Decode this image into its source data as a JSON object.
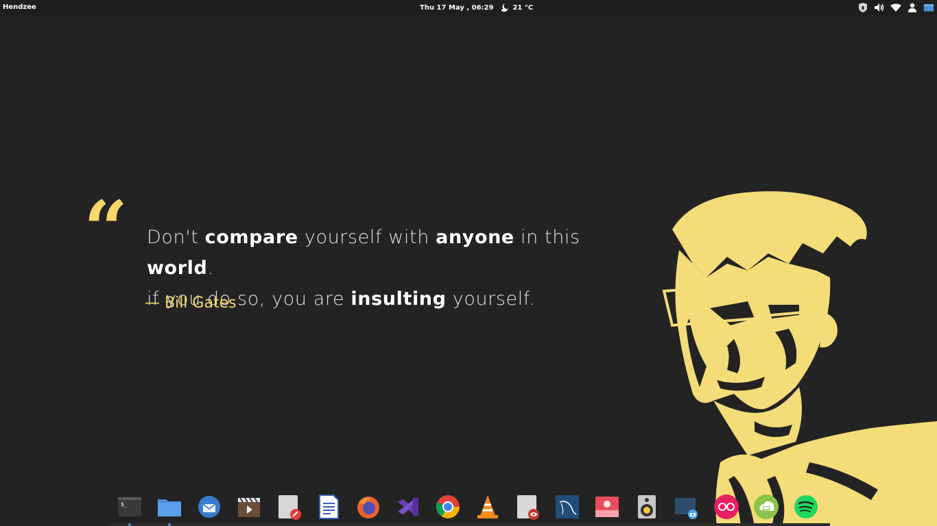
{
  "panel": {
    "app_menu_label": "Hendzee",
    "clock": "Thu 17 May , 06:29",
    "weather_temp": "21 °C",
    "indicators": [
      "security-icon",
      "volume-icon",
      "wifi-icon",
      "user-icon",
      "workspace-icon"
    ]
  },
  "wallpaper": {
    "quote_mark": "“",
    "line1": {
      "a": "Don't ",
      "b": "compare",
      "c": " yourself with ",
      "d": "anyone",
      "e": " in this ",
      "f": "world",
      "g": "."
    },
    "line2": {
      "a": "if you do so, you are ",
      "b": "insulting",
      "c": " yourself."
    },
    "author": "— Bill Gates",
    "accent_color": "#f6d86a"
  },
  "dock": {
    "items": [
      {
        "name": "terminal-icon"
      },
      {
        "name": "files-icon"
      },
      {
        "name": "thunderbird-icon"
      },
      {
        "name": "videos-icon"
      },
      {
        "name": "text-editor-icon"
      },
      {
        "name": "writer-icon"
      },
      {
        "name": "firefox-icon"
      },
      {
        "name": "visual-studio-code-icon"
      },
      {
        "name": "chrome-icon"
      },
      {
        "name": "vlc-icon"
      },
      {
        "name": "document-viewer-icon"
      },
      {
        "name": "mysql-workbench-icon"
      },
      {
        "name": "photos-icon"
      },
      {
        "name": "speaker-icon"
      },
      {
        "name": "screenshot-icon"
      },
      {
        "name": "flickr-icon"
      },
      {
        "name": "cloud-print-icon"
      },
      {
        "name": "spotify-icon"
      }
    ]
  }
}
